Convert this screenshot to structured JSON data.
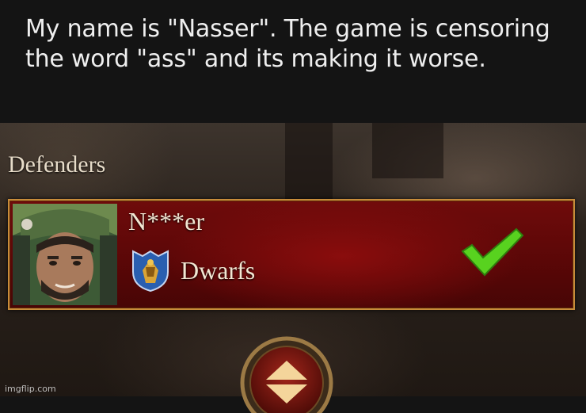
{
  "caption": {
    "text": "My name is \"Nasser\". The game is censoring the word \"ass\" and its making it worse."
  },
  "game": {
    "section_title": "Defenders",
    "player": {
      "name": "N***er",
      "faction": "Dwarfs",
      "faction_icon": "dwarfs-faction-shield-icon",
      "status_icon": "green-checkmark-icon",
      "ready": true
    },
    "toggle_icon": "up-down-arrows-icon"
  },
  "watermark": "imgflip.com",
  "colors": {
    "caption_bg": "#141414",
    "card_red": "#6f0b0b",
    "card_border": "#c88c3a",
    "check_green": "#58d21f"
  }
}
